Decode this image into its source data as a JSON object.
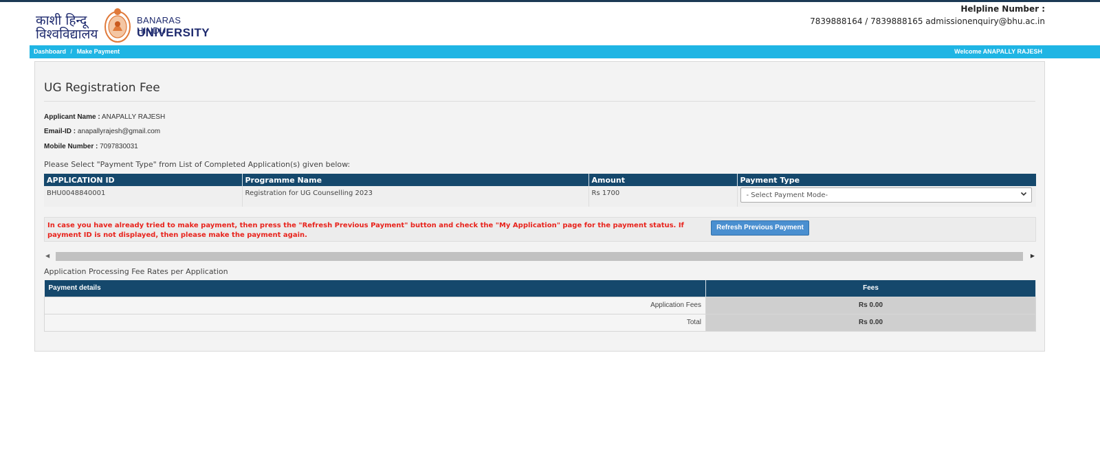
{
  "header": {
    "logo_hindi_line1": "काशी हिन्दू",
    "logo_hindi_line2": "विश्वविद्यालय",
    "logo_english_line1": "BANARAS HINDU",
    "logo_english_line2": "UNIVERSITY",
    "helpline_label": "Helpline Number :",
    "helpline_value": "7839888164 / 7839888165 admissionenquiry@bhu.ac.in"
  },
  "navbar": {
    "breadcrumbs": [
      "Dashboard",
      "Make Payment"
    ],
    "separator": "/",
    "welcome_text": "Welcome ANAPALLY RAJESH"
  },
  "page": {
    "title": "UG Registration Fee",
    "applicant_label": "Applicant Name :",
    "applicant_value": "ANAPALLY RAJESH",
    "email_label": "Email-ID :",
    "email_value": "anapallyrajesh@gmail.com",
    "mobile_label": "Mobile Number :",
    "mobile_value": "7097830031",
    "instruction": "Please Select \"Payment Type\" from List of Completed Application(s) given below:"
  },
  "applications_table": {
    "headers": [
      "APPLICATION ID",
      "Programme Name",
      "Amount",
      "Payment Type"
    ],
    "rows": [
      {
        "application_id": "BHU0048840001",
        "programme": "Registration for UG Counselling 2023",
        "amount": "Rs 1700",
        "payment_type_selected": "- Select Payment Mode-"
      }
    ]
  },
  "notice": {
    "text": "In case you have already tried to make payment, then press the \"Refresh Previous Payment\" button and check the \"My Application\" page for the payment status. If payment ID is not displayed, then please make the payment again.",
    "button_label": "Refresh Previous Payment"
  },
  "fee_section": {
    "caption": "Application Processing Fee Rates per Application",
    "headers": [
      "Payment details",
      "Fees"
    ],
    "rows": [
      {
        "label": "Application Fees",
        "value": "Rs 0.00"
      },
      {
        "label": "Total",
        "value": "Rs 0.00"
      }
    ]
  },
  "colors": {
    "navbar": "#1fb5e4",
    "table_header": "#15486c",
    "notice_text": "#e8231c",
    "button": "#4a8fd0",
    "logo_text": "#1e2a6e",
    "seal": "#e07a3a"
  },
  "icons": {
    "dropdown": "chevron-down-icon",
    "scroll_left": "scroll-left-icon",
    "scroll_right": "scroll-right-icon",
    "seal": "university-seal-icon"
  }
}
